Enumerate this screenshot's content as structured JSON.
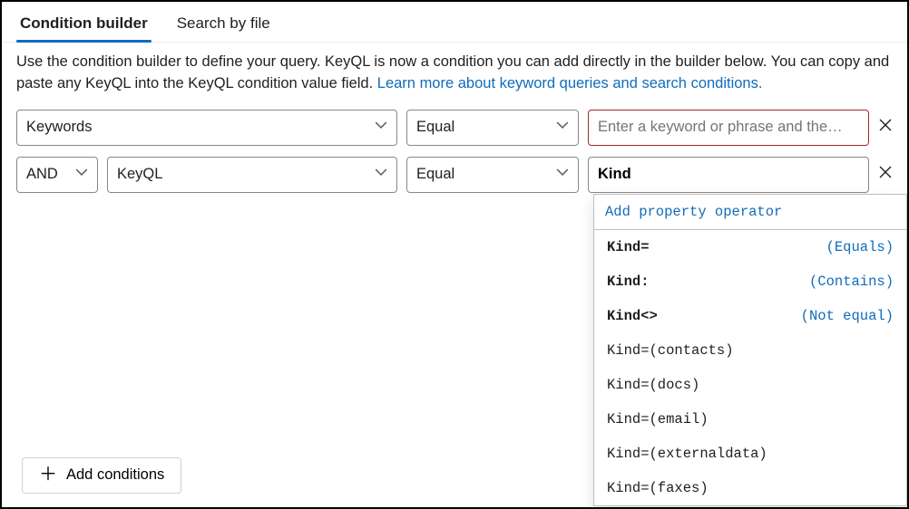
{
  "tabs": [
    {
      "label": "Condition builder",
      "active": true
    },
    {
      "label": "Search by file",
      "active": false
    }
  ],
  "description": {
    "text": "Use the condition builder to define your query. KeyQL is now a condition you can add directly in the builder below. You can copy and paste any KeyQL into the KeyQL condition value field. ",
    "link": "Learn more about keyword queries and search conditions."
  },
  "rows": [
    {
      "field": "Keywords",
      "operator": "Equal",
      "value": "",
      "placeholder": "Enter a keyword or phrase and the…",
      "invalid": true
    },
    {
      "bool": "AND",
      "field": "KeyQL",
      "operator": "Equal",
      "value": "Kind"
    }
  ],
  "add_button": "Add conditions",
  "dropdown": {
    "header": "Add property operator",
    "ops": [
      {
        "k": "Kind=",
        "hint": "(Equals)"
      },
      {
        "k": "Kind:",
        "hint": "(Contains)"
      },
      {
        "k": "Kind<>",
        "hint": "(Not equal)"
      }
    ],
    "suggestions": [
      "Kind=(contacts)",
      "Kind=(docs)",
      "Kind=(email)",
      "Kind=(externaldata)",
      "Kind=(faxes)"
    ]
  }
}
